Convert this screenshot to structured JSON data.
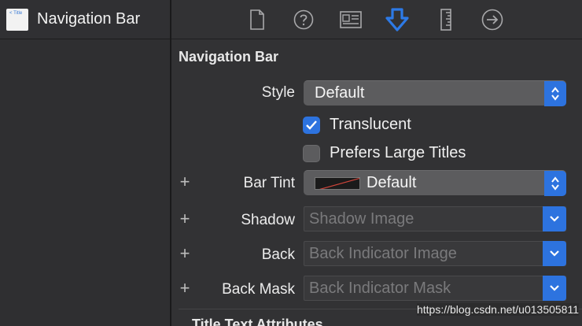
{
  "outline": {
    "thumbnail_text": "< Title",
    "item_label": "Navigation Bar"
  },
  "toolbar": {
    "tabs": [
      {
        "icon": "file-icon"
      },
      {
        "icon": "help-icon"
      },
      {
        "icon": "identity-icon"
      },
      {
        "icon": "attributes-icon",
        "selected": true
      },
      {
        "icon": "size-ruler-icon"
      },
      {
        "icon": "connections-arrow-icon"
      }
    ],
    "accent": "#2d73df"
  },
  "inspector": {
    "section_title": "Navigation Bar",
    "style": {
      "label": "Style",
      "value": "Default"
    },
    "translucent": {
      "label": "Translucent",
      "checked": true
    },
    "prefers_large_titles": {
      "label": "Prefers Large Titles",
      "checked": false
    },
    "bar_tint": {
      "label": "Bar Tint",
      "value": "Default"
    },
    "shadow": {
      "label": "Shadow",
      "placeholder": "Shadow Image"
    },
    "back": {
      "label": "Back",
      "placeholder": "Back Indicator Image"
    },
    "back_mask": {
      "label": "Back Mask",
      "placeholder": "Back Indicator Mask"
    },
    "next_section": "Title Text Attributes"
  },
  "watermark": "https://blog.csdn.net/u013505811"
}
